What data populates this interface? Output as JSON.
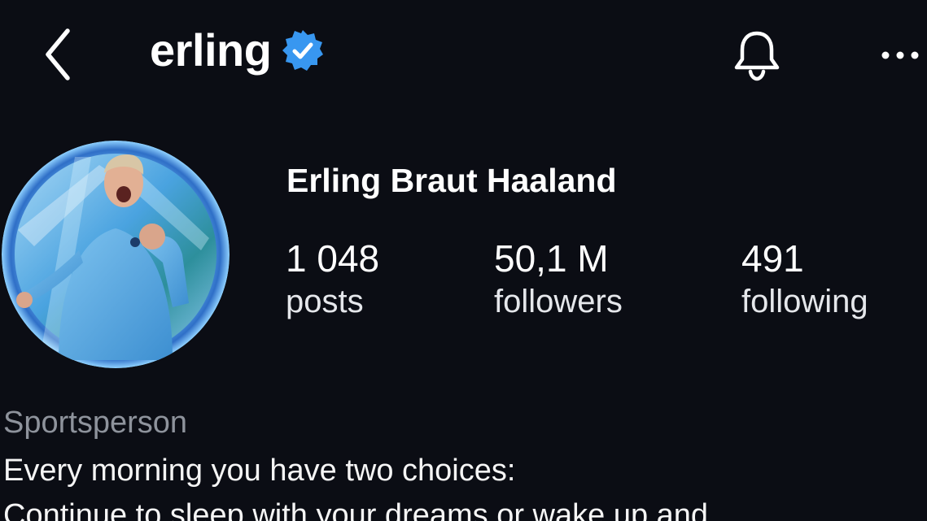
{
  "header": {
    "username": "erling",
    "back_icon": "chevron-left-icon",
    "verified_icon": "verified-badge-icon",
    "notifications_icon": "bell-icon",
    "more_icon": "more-horizontal-icon"
  },
  "profile": {
    "full_name": "Erling Braut Haaland",
    "avatar_icon": "profile-photo",
    "stats": [
      {
        "value": "1 048",
        "label": "posts"
      },
      {
        "value": "50,1 M",
        "label": "followers"
      },
      {
        "value": "491",
        "label": "following"
      }
    ]
  },
  "bio": {
    "category": "Sportsperson",
    "lines": [
      "Every morning you have two choices:",
      "Continue to sleep with your dreams or wake up and"
    ]
  },
  "colors": {
    "background": "#0b0d14",
    "verified": "#3897f0",
    "text_primary": "#ffffff",
    "text_secondary": "#8e939c"
  }
}
